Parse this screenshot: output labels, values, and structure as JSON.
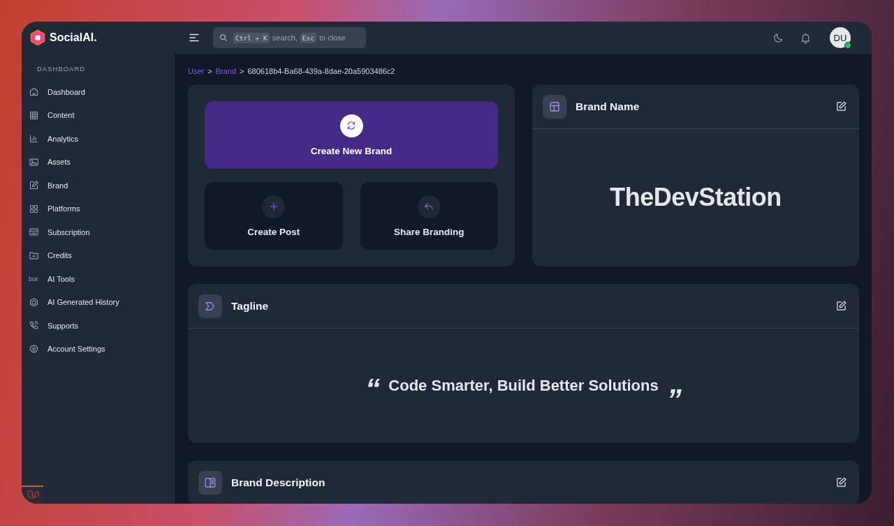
{
  "app": {
    "name": "SocialAI."
  },
  "search": {
    "hint": [
      {
        "kind": "key",
        "text": "Ctrl + K"
      },
      {
        "kind": "text",
        "text": "search,"
      },
      {
        "kind": "key",
        "text": "Esc"
      },
      {
        "kind": "text",
        "text": "to close"
      }
    ]
  },
  "user": {
    "initials": "DU",
    "online": true
  },
  "sidebar": {
    "section": "DASHBOARD",
    "items": [
      {
        "label": "Dashboard"
      },
      {
        "label": "Content"
      },
      {
        "label": "Analytics"
      },
      {
        "label": "Assets"
      },
      {
        "label": "Brand"
      },
      {
        "label": "Platforms"
      },
      {
        "label": "Subscription"
      },
      {
        "label": "Credits"
      },
      {
        "label": "AI Tools",
        "icon_text": "box"
      },
      {
        "label": "AI Generated History"
      },
      {
        "label": "Supports"
      },
      {
        "label": "Account Settings"
      }
    ]
  },
  "breadcrumb": {
    "separator": ">",
    "items": [
      {
        "label": "User",
        "link": true
      },
      {
        "label": "Brand",
        "link": true
      },
      {
        "label": "680618b4-Ba68-439a-8dae-20a5903486c2",
        "link": false
      }
    ]
  },
  "actions": [
    {
      "kind": "primary",
      "label": "Create New Brand"
    },
    {
      "kind": "secondary",
      "label": "Create Post"
    },
    {
      "kind": "secondary",
      "label": "Share Branding"
    }
  ],
  "sections": [
    {
      "kind": "name",
      "title": "Brand Name",
      "value": "TheDevStation"
    },
    {
      "kind": "tagline",
      "title": "Tagline",
      "open_quote": "“",
      "value": "Code Smarter, Build Better Solutions",
      "close_quote": "”"
    },
    {
      "kind": "description",
      "title": "Brand Description"
    }
  ]
}
